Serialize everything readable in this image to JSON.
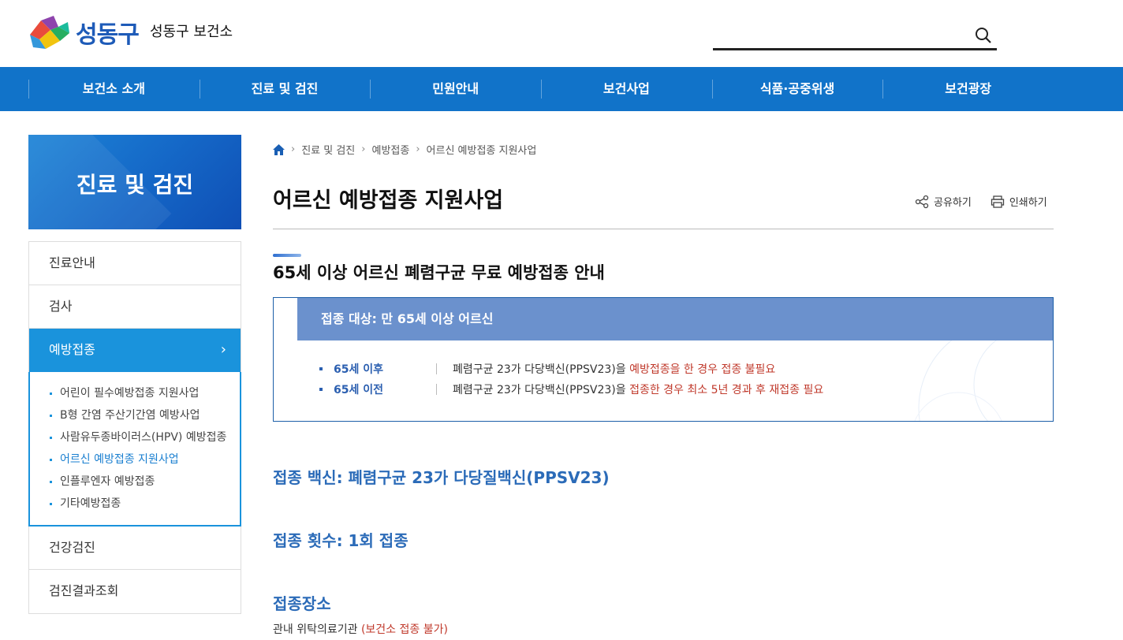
{
  "header": {
    "logo_text": "성동구",
    "site_name": "성동구 보건소",
    "search": {
      "placeholder": ""
    }
  },
  "gnb": {
    "items": [
      {
        "label": "보건소 소개"
      },
      {
        "label": "진료 및 검진"
      },
      {
        "label": "민원안내"
      },
      {
        "label": "보건사업"
      },
      {
        "label": "식품·공중위생"
      },
      {
        "label": "보건광장"
      }
    ]
  },
  "lnb": {
    "title": "진료 및 검진",
    "items": [
      {
        "label": "진료안내"
      },
      {
        "label": "검사"
      },
      {
        "label": "예방접종"
      },
      {
        "label": "건강검진"
      },
      {
        "label": "검진결과조회"
      }
    ],
    "sub_items": [
      {
        "label": "어린이 필수예방접종 지원사업"
      },
      {
        "label": "B형 간염 주산기간염 예방사업"
      },
      {
        "label": "사람유두종바이러스(HPV) 예방접종"
      },
      {
        "label": "어르신 예방접종 지원사업"
      },
      {
        "label": "인플루엔자 예방접종"
      },
      {
        "label": "기타예방접종"
      }
    ]
  },
  "breadcrumb": {
    "items": [
      "진료 및 검진",
      "예방접종",
      "어르신 예방접종 지원사업"
    ],
    "sep": "›"
  },
  "page": {
    "title": "어르신 예방접종 지원사업",
    "share_label": "공유하기",
    "print_label": "인쇄하기"
  },
  "section": {
    "title": "65세 이상 어르신 폐렴구균 무료 예방접종 안내",
    "box_head": "접종 대상: 만 65세 이상 어르신",
    "rows": [
      {
        "key": "65세 이후",
        "text": "폐렴구균 23가 다당백신(PPSV23)을 ",
        "highlight": "예방접종을 한 경우 접종 불필요"
      },
      {
        "key": "65세 이전",
        "text": "폐렴구균 23가 다당백신(PPSV23)을 ",
        "highlight": "접종한 경우 최소 5년 경과 후 재접종 필요"
      }
    ],
    "vaccine": "접종 백신: 폐렴구균 23가 다당질백신(PPSV23)",
    "count": "접종 횟수: 1회 접종",
    "place_title": "접종장소",
    "place_desc": "관내 위탁의료기관 ",
    "place_note": "(보건소 접종 불가)"
  },
  "colors": {
    "gnb": "#1173c9",
    "lnb_active": "#1a93dc",
    "highlight_red": "#c0392b",
    "info_blue": "#2b6bb8"
  }
}
